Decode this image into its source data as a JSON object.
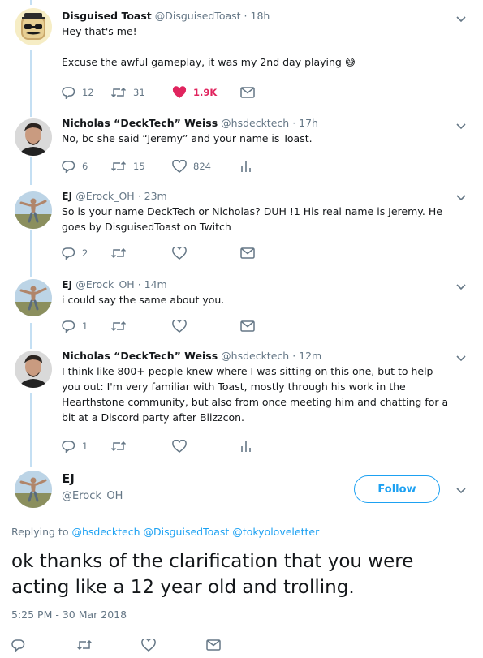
{
  "colors": {
    "accent": "#1da1f2",
    "like": "#e0245e",
    "muted": "#657786",
    "thread": "#c4dff3"
  },
  "replies": [
    {
      "name": "Disguised Toast",
      "handle": "@DisguisedToast",
      "dot": "·",
      "time": "18h",
      "avatar": "toast-avatar",
      "lines": [
        "Hey that's me!",
        "Excuse the awful gameplay, it was my 2nd day playing 😅"
      ],
      "reply_count": "12",
      "retweet_count": "31",
      "like_count": "1.9K",
      "liked": true
    },
    {
      "name": "Nicholas “DeckTech” Weiss",
      "handle": "@hsdecktech",
      "dot": "·",
      "time": "17h",
      "avatar": "decktech-avatar",
      "lines": [
        "No, bc she said “Jeremy” and your name is Toast."
      ],
      "reply_count": "6",
      "retweet_count": "15",
      "like_count": "824"
    },
    {
      "name": "EJ",
      "handle": "@Erock_OH",
      "dot": "·",
      "time": "23m",
      "avatar": "ej-avatar",
      "lines": [
        "So is your name DeckTech or Nicholas?  DUH !1 His real name is Jeremy. He goes by DisguisedToast on Twitch"
      ],
      "reply_count": "2",
      "retweet_count": "",
      "like_count": ""
    },
    {
      "name": "EJ",
      "handle": "@Erock_OH",
      "dot": "·",
      "time": "14m",
      "avatar": "ej-avatar",
      "lines": [
        "i could say the same about you."
      ],
      "reply_count": "1",
      "retweet_count": "",
      "like_count": ""
    },
    {
      "name": "Nicholas “DeckTech” Weiss",
      "handle": "@hsdecktech",
      "dot": "·",
      "time": "12m",
      "avatar": "decktech-avatar",
      "lines": [
        "I think like 800+ people knew where I was sitting on this one, but to help you out: I'm very familiar with Toast, mostly through his work in the Hearthstone community, but also from once meeting him and chatting for a bit at a Discord party after Blizzcon."
      ],
      "reply_count": "1",
      "retweet_count": "",
      "like_count": ""
    }
  ],
  "main": {
    "name": "EJ",
    "handle": "@Erock_OH",
    "follow_label": "Follow",
    "replying_prefix": "Replying to",
    "replying_to": [
      "@hsdecktech",
      "@DisguisedToast",
      "@tokyoloveletter"
    ],
    "text": "ok thanks of the clarification that you were acting like a 12 year old and trolling.",
    "timestamp": "5:25 PM - 30 Mar 2018"
  }
}
